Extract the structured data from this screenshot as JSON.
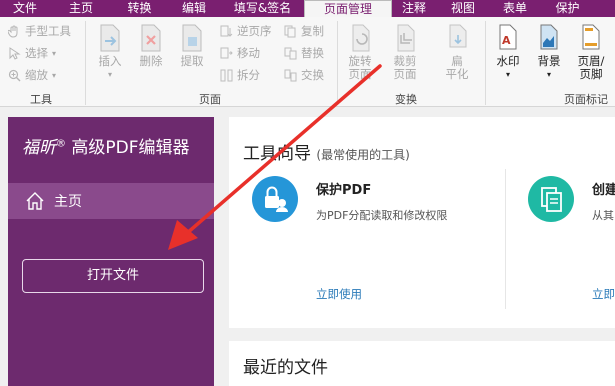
{
  "menu": [
    "文件",
    "主页",
    "转换",
    "编辑",
    "填写&签名",
    "页面管理",
    "注释",
    "视图",
    "表单",
    "保护"
  ],
  "menu_active_index": 5,
  "ribbon": {
    "tools_group": {
      "label": "工具",
      "items": [
        "手型工具",
        "选择",
        "缩放"
      ]
    },
    "pages_group": {
      "label": "页面",
      "big": [
        "插入",
        "删除",
        "提取"
      ],
      "small_col1": [
        "逆页序",
        "移动",
        "拆分"
      ],
      "small_col2": [
        "复制",
        "替换",
        "交换"
      ]
    },
    "transform_group": {
      "label": "变换",
      "rotate": [
        "旋转",
        "页面"
      ],
      "crop": [
        "裁剪",
        "页面"
      ],
      "flatten": [
        "扁",
        "平化"
      ]
    },
    "pagemark_group": {
      "label": "页面标记",
      "watermark": "水印",
      "background": "背景",
      "header_footer": [
        "页眉/",
        "页脚"
      ]
    }
  },
  "sidebar": {
    "brand_italic": "福昕",
    "brand_reg": "®",
    "brand_text": "高级PDF编辑器",
    "home": "主页",
    "open_file": "打开文件"
  },
  "main": {
    "guide_title": "工具向导",
    "guide_subtitle": "(最常使用的工具)",
    "tool1": {
      "title": "保护PDF",
      "desc": "为PDF分配读取和修改权限",
      "link": "立即使用"
    },
    "tool2": {
      "title": "创建",
      "desc": "从其",
      "link": "立即"
    },
    "recent_title": "最近的文件"
  },
  "colors": {
    "brand_purple": "#7a1f70",
    "panel_purple": "#6d2a6e",
    "accent_blue": "#2596d8",
    "accent_teal": "#1fb9a4",
    "arrow_red": "#e8302a"
  }
}
